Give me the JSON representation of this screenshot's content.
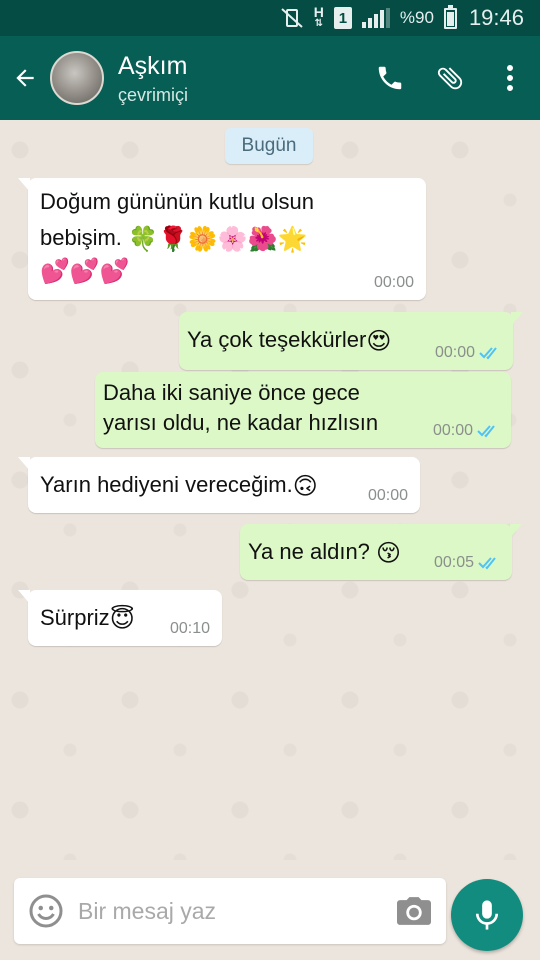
{
  "status_bar": {
    "sim_label": "1",
    "network_label": "H",
    "battery_percent": "%90",
    "time": "19:46"
  },
  "header": {
    "contact_name": "Aşkım",
    "contact_status": "çevrimiçi"
  },
  "chat": {
    "date_chip": "Bugün",
    "messages": [
      {
        "direction": "in",
        "line1": "Doğum gününün kutlu olsun",
        "line2": "bebişim.",
        "emoji": [
          "🍀",
          "🌹",
          "🌼",
          "🌸",
          "🌺",
          "🌟",
          "💕",
          "💕",
          "💕"
        ],
        "time": "00:00"
      },
      {
        "direction": "out",
        "text": "Ya çok teşekkürler",
        "emoji": "😍",
        "time": "00:00",
        "read": true
      },
      {
        "direction": "out",
        "line1": "Daha iki saniye önce gece",
        "line2": "yarısı oldu, ne kadar hızlısın",
        "time": "00:00",
        "read": true
      },
      {
        "direction": "in",
        "text": "Yarın hediyeni vereceğim.",
        "emoji": "🙃",
        "time": "00:00"
      },
      {
        "direction": "out",
        "text": "Ya ne aldın?",
        "emoji": "😚",
        "time": "00:05",
        "read": true
      },
      {
        "direction": "in",
        "text": "Sürpriz",
        "emoji": "😇",
        "time": "00:10"
      }
    ]
  },
  "composer": {
    "placeholder": "Bir mesaj yaz"
  },
  "colors": {
    "header": "#075e54",
    "status_bar": "#054d44",
    "outgoing_bubble": "#dcf8c6",
    "incoming_bubble": "#ffffff",
    "read_ticks": "#4fc3f7",
    "fab": "#128c7e"
  },
  "icons": {
    "back": "arrow-left-icon",
    "call": "phone-icon",
    "attach": "paperclip-icon",
    "menu": "more-vert-icon",
    "emoji": "emoji-icon",
    "camera": "camera-icon",
    "mic": "mic-icon"
  }
}
